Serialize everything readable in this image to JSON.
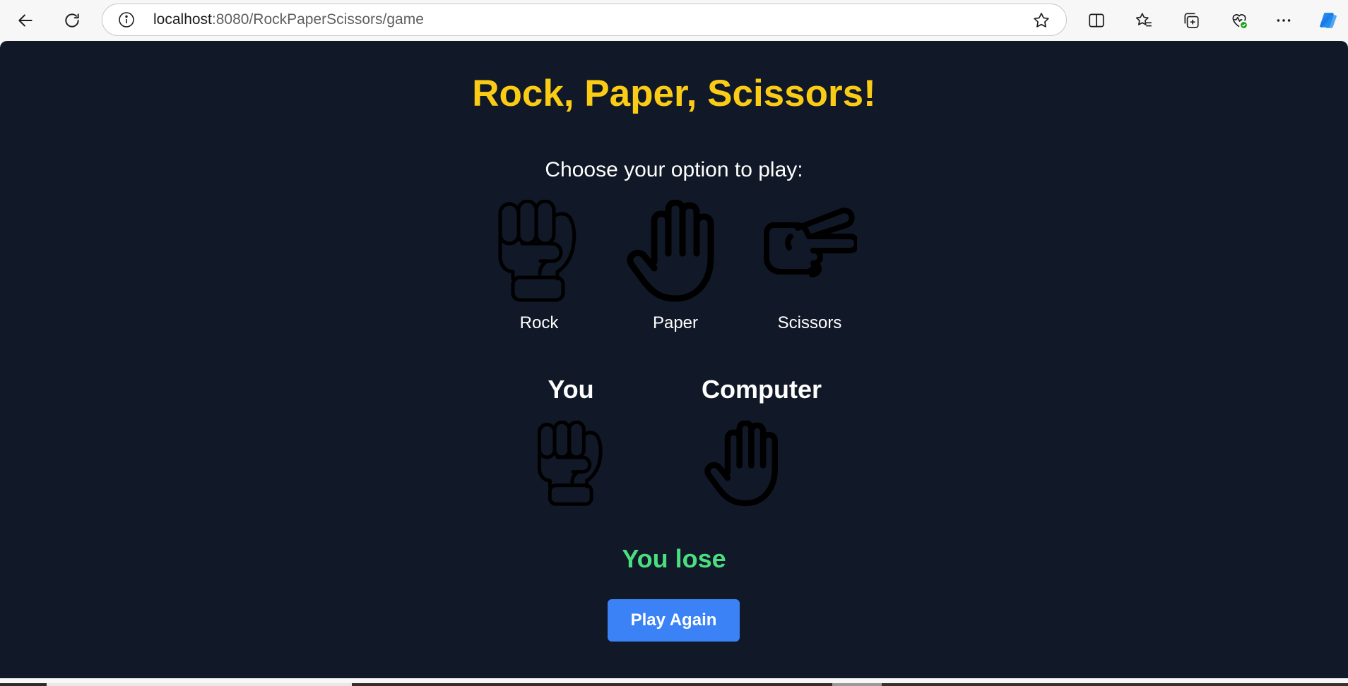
{
  "browser": {
    "url_host": "localhost",
    "url_path": ":8080/RockPaperScissors/game"
  },
  "game": {
    "title": "Rock, Paper, Scissors!",
    "prompt": "Choose your option to play:",
    "options": [
      {
        "label": "Rock",
        "icon": "fist-icon"
      },
      {
        "label": "Paper",
        "icon": "open-hand-icon"
      },
      {
        "label": "Scissors",
        "icon": "scissors-hand-icon"
      }
    ],
    "player_label": "You",
    "computer_label": "Computer",
    "player_choice_icon": "fist-icon",
    "computer_choice_icon": "open-hand-icon",
    "result": "You lose",
    "play_again_label": "Play Again"
  },
  "colors": {
    "page_background": "#111827",
    "title": "#facc15",
    "result": "#4ade80",
    "button": "#3b82f6"
  }
}
